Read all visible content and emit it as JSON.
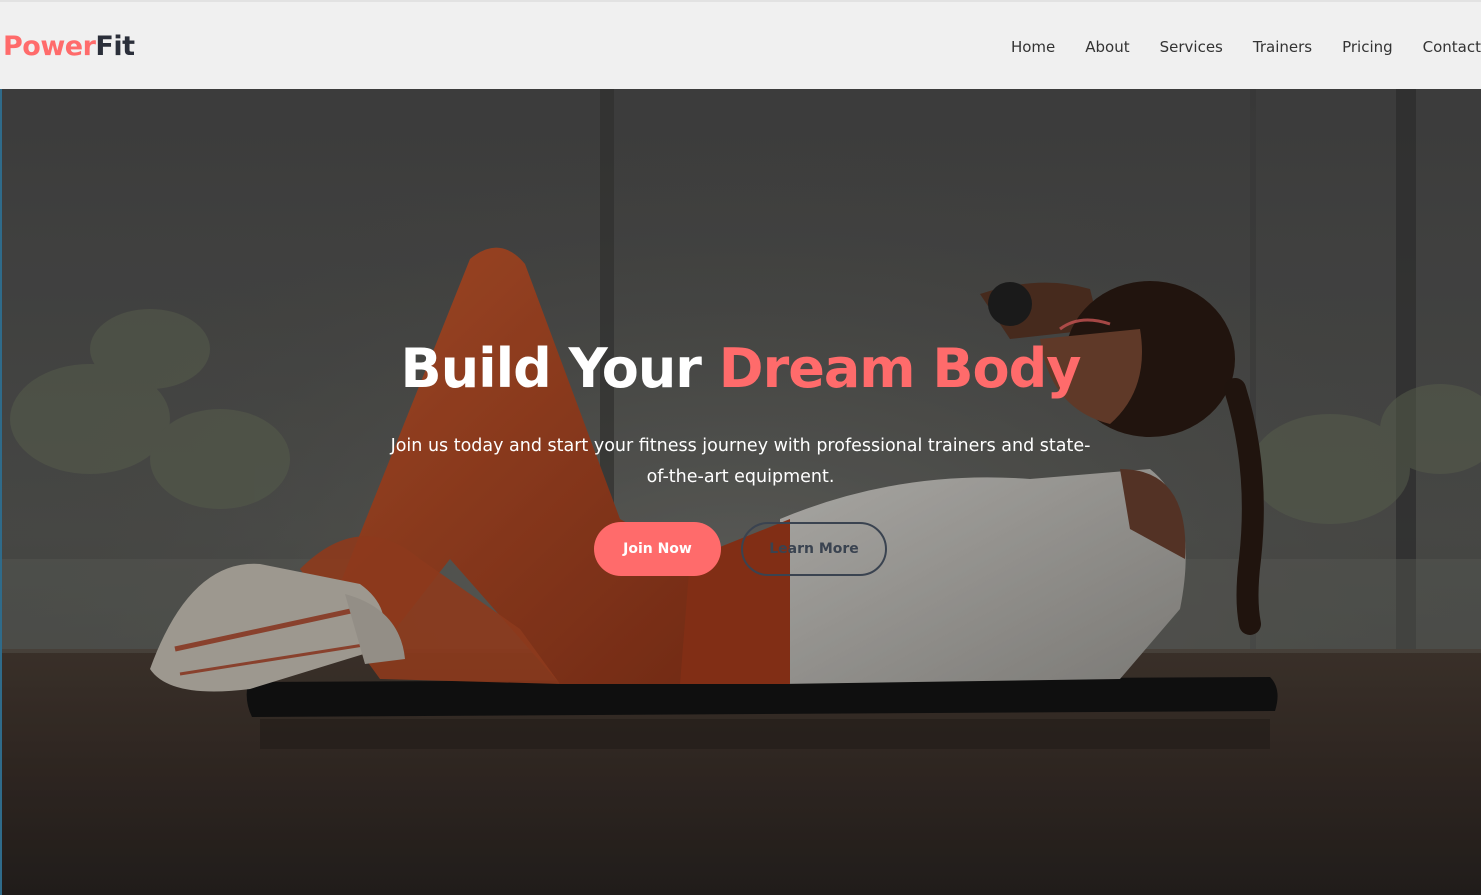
{
  "brand": {
    "part1": "Power",
    "part2": "Fit",
    "color_primary": "#ff6b6b",
    "color_dark": "#2b2f3a"
  },
  "nav": {
    "items": [
      {
        "label": "Home"
      },
      {
        "label": "About"
      },
      {
        "label": "Services"
      },
      {
        "label": "Trainers"
      },
      {
        "label": "Pricing"
      },
      {
        "label": "Contact"
      }
    ]
  },
  "hero": {
    "title_plain": "Build Your ",
    "title_highlight": "Dream Body",
    "subtitle": "Join us today and start your fitness journey with professional trainers and state-of-the-art equipment.",
    "primary_button": "Join Now",
    "secondary_button": "Learn More",
    "image_subject": "woman doing crunches on a mat in a gym"
  }
}
